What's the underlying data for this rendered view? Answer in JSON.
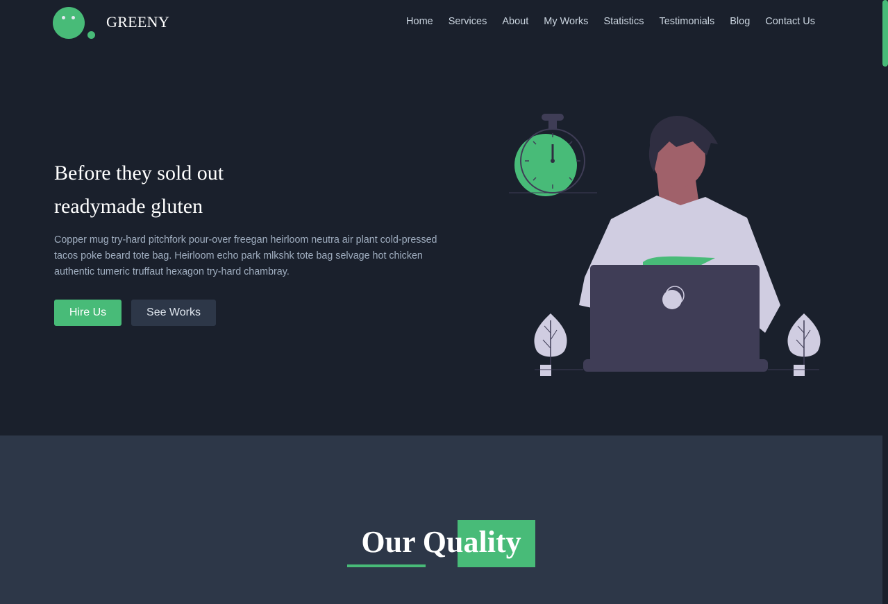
{
  "brand": {
    "name": "GREENY"
  },
  "nav": {
    "items": [
      {
        "label": "Home"
      },
      {
        "label": "Services"
      },
      {
        "label": "About"
      },
      {
        "label": "My Works"
      },
      {
        "label": "Statistics"
      },
      {
        "label": "Testimonials"
      },
      {
        "label": "Blog"
      },
      {
        "label": "Contact Us"
      }
    ]
  },
  "hero": {
    "headline_line1": "Before they sold out",
    "headline_line2": "readymade gluten",
    "description": "Copper mug try-hard pitchfork pour-over freegan heirloom neutra air plant cold-pressed tacos poke beard tote bag. Heirloom echo park mlkshk tote bag selvage hot chicken authentic tumeric truffaut hexagon try-hard chambray.",
    "primary_button": "Hire Us",
    "secondary_button": "See Works"
  },
  "quality": {
    "title": "Our Quality"
  },
  "colors": {
    "accent": "#48bb78",
    "background_dark": "#1a202c",
    "background_section": "#2d3748",
    "text_muted": "#a0aec0"
  }
}
